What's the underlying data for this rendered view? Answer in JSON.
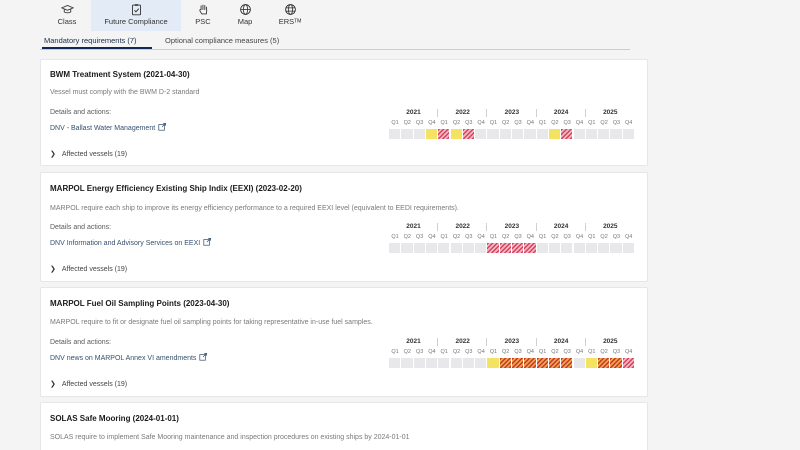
{
  "nav": {
    "items": [
      {
        "label": "Class",
        "icon": "graduation-cap-icon"
      },
      {
        "label": "Future Compliance",
        "icon": "clipboard-check-icon"
      },
      {
        "label": "PSC",
        "icon": "hand-icon"
      },
      {
        "label": "Map",
        "icon": "globe-icon"
      },
      {
        "label": "ERSᵀᴹ",
        "icon": "globe-grid-icon"
      }
    ],
    "active": "Future Compliance"
  },
  "tabs": [
    {
      "label": "Mandatory requirements (7)"
    },
    {
      "label": "Optional compliance measures (5)"
    }
  ],
  "timeline": {
    "years": [
      "2021",
      "2022",
      "2023",
      "2024",
      "2025"
    ],
    "quarters": [
      "Q1",
      "Q2",
      "Q3",
      "Q4"
    ]
  },
  "cards": [
    {
      "title": "BWM Treatment System (2021-04-30)",
      "description": "Vessel must comply with the BWM D-2 standard",
      "details_label": "Details and actions:",
      "link": "DNV - Ballast Water Management",
      "affected": "Affected vessels (19)",
      "cells": {
        "3": "yellow",
        "4": "hatched",
        "5": "yellow",
        "6": "hatched",
        "13": "yellow",
        "14": "hatched"
      }
    },
    {
      "title": "MARPOL Energy Efficiency Existing Ship Indix (EEXI) (2023-02-20)",
      "description": "MARPOL require each ship to improve its energy efficiency performance to a required EEXI level (equivalent to EEDI requirements).",
      "details_label": "Details and actions:",
      "link": "DNV Information and Advisory Services on EEXI",
      "affected": "Affected vessels (19)",
      "cells": {
        "8": "hatched",
        "9": "hatched",
        "10": "hatched",
        "11": "hatched"
      }
    },
    {
      "title": "MARPOL Fuel Oil Sampling Points (2023-04-30)",
      "description": "MARPOL require to fit or designate fuel oil sampling points for taking representative in-use fuel samples.",
      "details_label": "Details and actions:",
      "link": "DNV news on MARPOL Annex VI amendments",
      "affected": "Affected vessels (19)",
      "cells": {
        "8": "yellow",
        "9": "hatched-orange",
        "10": "hatched-orange",
        "11": "hatched-orange",
        "12": "hatched-orange",
        "13": "hatched-orange",
        "14": "hatched-orange",
        "16": "yellow",
        "17": "hatched-orange",
        "18": "hatched-orange",
        "19": "hatched"
      }
    },
    {
      "title": "SOLAS Safe Mooring (2024-01-01)",
      "description": "SOLAS require to implement Safe Mooring maintenance and inspection procedures on existing ships by 2024-01-01"
    }
  ]
}
